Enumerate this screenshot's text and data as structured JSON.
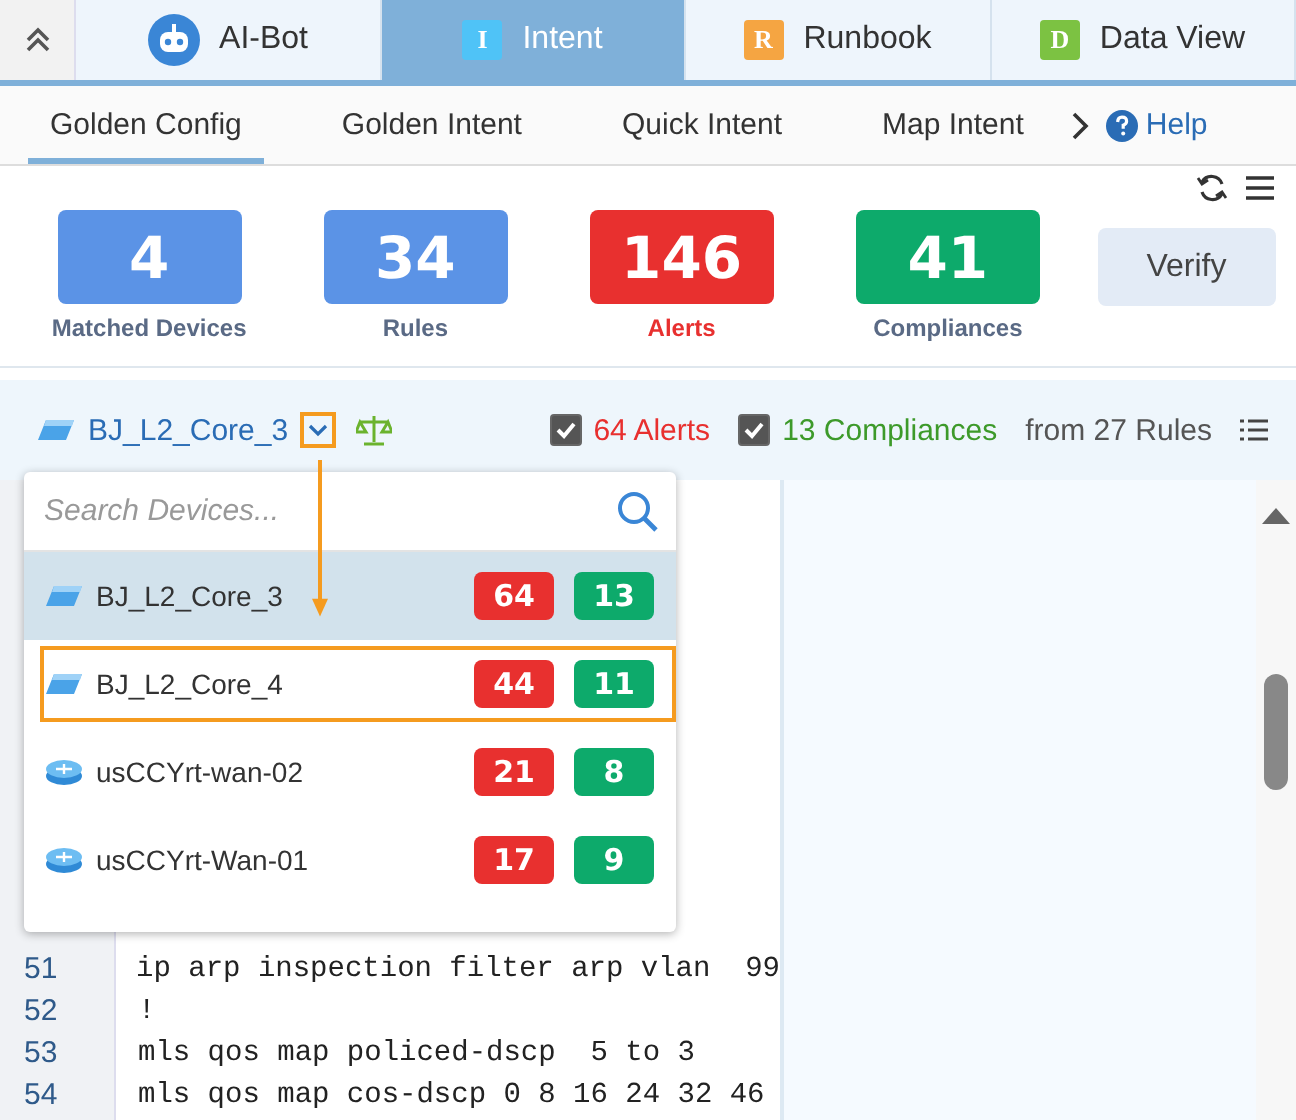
{
  "top_tabs": [
    {
      "label": "AI-Bot",
      "kind": "bot",
      "selected": false
    },
    {
      "label": "Intent",
      "kind": "letter",
      "badge": "I",
      "color": "#4fc3f7",
      "selected": true
    },
    {
      "label": "Runbook",
      "kind": "letter",
      "badge": "R",
      "color": "#f5a542",
      "selected": false
    },
    {
      "label": "Data View",
      "kind": "letter",
      "badge": "D",
      "color": "#7cc242",
      "selected": false
    }
  ],
  "sub_tabs": [
    {
      "label": "Golden Config",
      "selected": true
    },
    {
      "label": "Golden Intent",
      "selected": false
    },
    {
      "label": "Quick Intent",
      "selected": false
    },
    {
      "label": "Map Intent",
      "selected": false
    }
  ],
  "help": "Help",
  "stats": [
    {
      "value": "4",
      "label": "Matched Devices",
      "kind": "count",
      "color": "#5b93e6"
    },
    {
      "value": "34",
      "label": "Rules",
      "kind": "count",
      "color": "#5b93e6"
    },
    {
      "value": "146",
      "label": "Alerts",
      "kind": "alert",
      "color": "#e8302f"
    },
    {
      "value": "41",
      "label": "Compliances",
      "kind": "count",
      "color": "#0daa6b"
    }
  ],
  "verify_button": "Verify",
  "device_bar": {
    "device": "BJ_L2_Core_3",
    "filters": [
      {
        "label": "64 Alerts",
        "kind": "alert",
        "checked": true
      },
      {
        "label": "13 Compliances",
        "kind": "compliance",
        "checked": true
      }
    ],
    "summary": "from 27 Rules"
  },
  "dropdown": {
    "placeholder": "Search Devices...",
    "devices": [
      {
        "name": "BJ_L2_Core_3",
        "kind": "switch",
        "alerts": "64",
        "compliances": "13",
        "selected": true,
        "highlighted": false
      },
      {
        "name": "BJ_L2_Core_4",
        "kind": "switch",
        "alerts": "44",
        "compliances": "11",
        "selected": false,
        "highlighted": true
      },
      {
        "name": "usCCYrt-wan-02",
        "kind": "router",
        "alerts": "21",
        "compliances": "8",
        "selected": false,
        "highlighted": false
      },
      {
        "name": "usCCYrt-Wan-01",
        "kind": "router",
        "alerts": "17",
        "compliances": "9",
        "selected": false,
        "highlighted": false
      }
    ]
  },
  "code": {
    "lines": [
      {
        "number": "51",
        "text": "ip arp inspection filter arp vlan  99"
      },
      {
        "number": "52",
        "text": "!"
      },
      {
        "number": "53",
        "text": "mls qos map policed-dscp  5 to 3"
      },
      {
        "number": "54",
        "text": "mls qos map cos-dscp 0 8 16 24 32 46"
      }
    ]
  }
}
